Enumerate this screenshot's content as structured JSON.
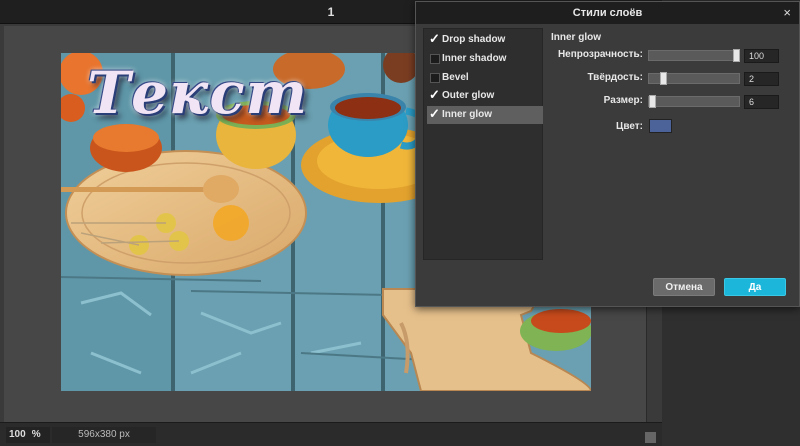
{
  "doc": {
    "title": "1",
    "close": "×",
    "zoom_value": "100",
    "zoom_unit": "%",
    "size": "596x380 px"
  },
  "photo": {
    "overlay_text": "Текст"
  },
  "dialog": {
    "title": "Стили слоёв",
    "close": "×",
    "styles": [
      {
        "label": "Drop shadow",
        "checked": true
      },
      {
        "label": "Inner shadow",
        "checked": false
      },
      {
        "label": "Bevel",
        "checked": false
      },
      {
        "label": "Outer glow",
        "checked": true
      },
      {
        "label": "Inner glow",
        "checked": true,
        "selected": true
      }
    ],
    "panel_title": "Inner glow",
    "opacity": {
      "label": "Непрозрачность:",
      "value": "100",
      "fraction": 1.0
    },
    "hardness": {
      "label": "Твёрдость:",
      "value": "2",
      "fraction": 0.12
    },
    "size": {
      "label": "Размер:",
      "value": "6",
      "fraction": 0.02
    },
    "color": {
      "label": "Цвет:",
      "value": "#4b6398"
    },
    "cancel": "Отмена",
    "ok": "Да"
  },
  "icons": {
    "check": "checkmark-icon",
    "close": "close-icon",
    "grip": "resize-grip-icon"
  }
}
